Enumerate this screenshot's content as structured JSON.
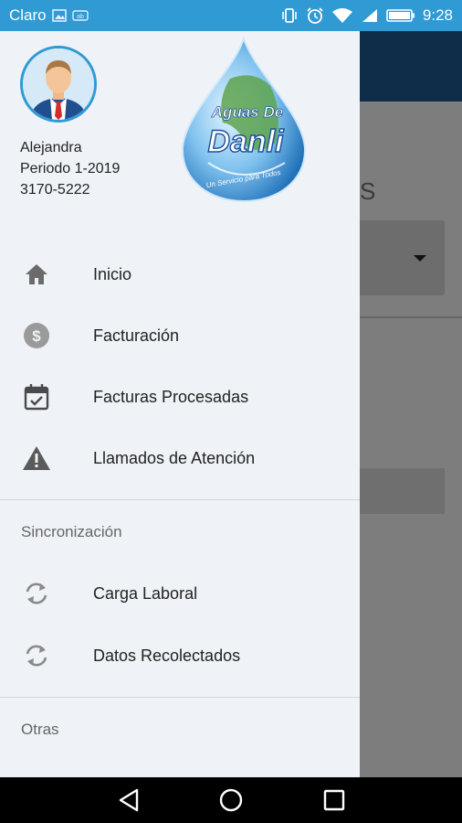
{
  "status_bar": {
    "carrier": "Claro",
    "time": "9:28",
    "bg_color": "#2f9ad3"
  },
  "user": {
    "name": "Alejandra",
    "period": "Periodo 1-2019",
    "phone": "3170-5222"
  },
  "logo": {
    "line1": "Aguas De",
    "line2": "Danli",
    "tagline": "Un Servicio para Todos"
  },
  "menu": {
    "items": [
      {
        "label": "Inicio",
        "icon": "home-icon"
      },
      {
        "label": "Facturación",
        "icon": "dollar-circle-icon"
      },
      {
        "label": "Facturas Procesadas",
        "icon": "calendar-check-icon"
      },
      {
        "label": "Llamados de Atención",
        "icon": "warning-icon"
      }
    ],
    "sync_section": "Sincronización",
    "sync_items": [
      {
        "label": "Carga Laboral",
        "icon": "sync-icon"
      },
      {
        "label": "Datos Recolectados",
        "icon": "sync-icon"
      }
    ],
    "other_section": "Otras"
  },
  "background_app": {
    "appbar_color": "#0f2d49",
    "partial_label": "S"
  },
  "nav_bar": {
    "buttons": [
      "back-icon",
      "home-circle-icon",
      "recents-icon"
    ]
  }
}
